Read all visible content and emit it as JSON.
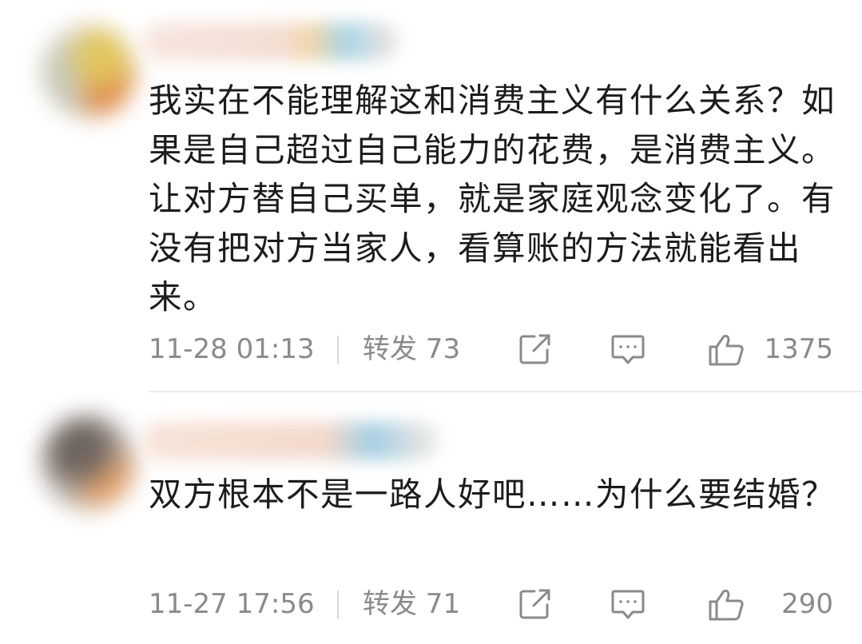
{
  "comments": [
    {
      "text": "我实在不能理解这和消费主义有什么关系？如果是自己超过自己能力的花费，是消费主义。让对方替自己买单，就是家庭观念变化了。有没有把对方当家人，看算账的方法就能看出来。",
      "timestamp": "11-28 01:13",
      "forward_label": "转发 73",
      "likes": "1375",
      "icons": {
        "share": "share-icon",
        "comment": "comment-icon",
        "like": "thumbs-up-icon"
      }
    },
    {
      "text": "双方根本不是一路人好吧……为什么要结婚？",
      "timestamp": "11-27 17:56",
      "forward_label": "转发 71",
      "likes": "290",
      "icons": {
        "share": "share-icon",
        "comment": "comment-icon",
        "like": "thumbs-up-icon"
      }
    }
  ],
  "colors": {
    "text": "#1c1c1c",
    "meta": "#8a8a8a",
    "divider": "#ececec"
  }
}
